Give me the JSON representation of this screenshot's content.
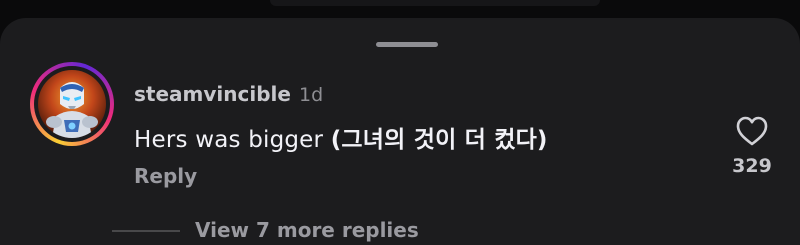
{
  "comment": {
    "username": "steamvincible",
    "timestamp": "1d",
    "text_english": "Hers was bigger",
    "text_korean": "(그녀의 것이 더 컸다)",
    "reply_label": "Reply",
    "like_count": "329",
    "liked": false
  },
  "replies": {
    "view_more_label": "View 7 more replies"
  },
  "icons": {
    "heart": "heart-outline-icon",
    "drag_handle": "drag-handle"
  },
  "colors": {
    "sheet_background": "#1c1c1e",
    "page_background": "#0a0a0b",
    "primary_text": "#f2f2f7",
    "secondary_text": "#8e8e93",
    "story_ring_start": "#f9ce34",
    "story_ring_mid": "#ee2a7b",
    "story_ring_end": "#6228d7"
  }
}
